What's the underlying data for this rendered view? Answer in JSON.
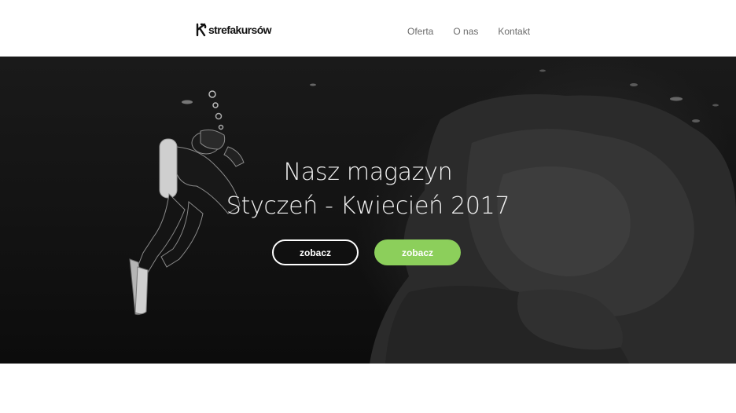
{
  "header": {
    "logo_text": "strefakursów",
    "nav": [
      "Oferta",
      "O nas",
      "Kontakt"
    ]
  },
  "hero": {
    "title_line1": "Nasz magazyn",
    "title_line2": "Styczeń - Kwiecień 2017",
    "button_outline_label": "zobacz",
    "button_green_label": "zobacz",
    "background_image": "underwater-scuba-diver-photo"
  },
  "colors": {
    "accent_green": "#8ccf5b",
    "nav_text": "#6b6b6b",
    "hero_text": "#f2f2f2"
  }
}
